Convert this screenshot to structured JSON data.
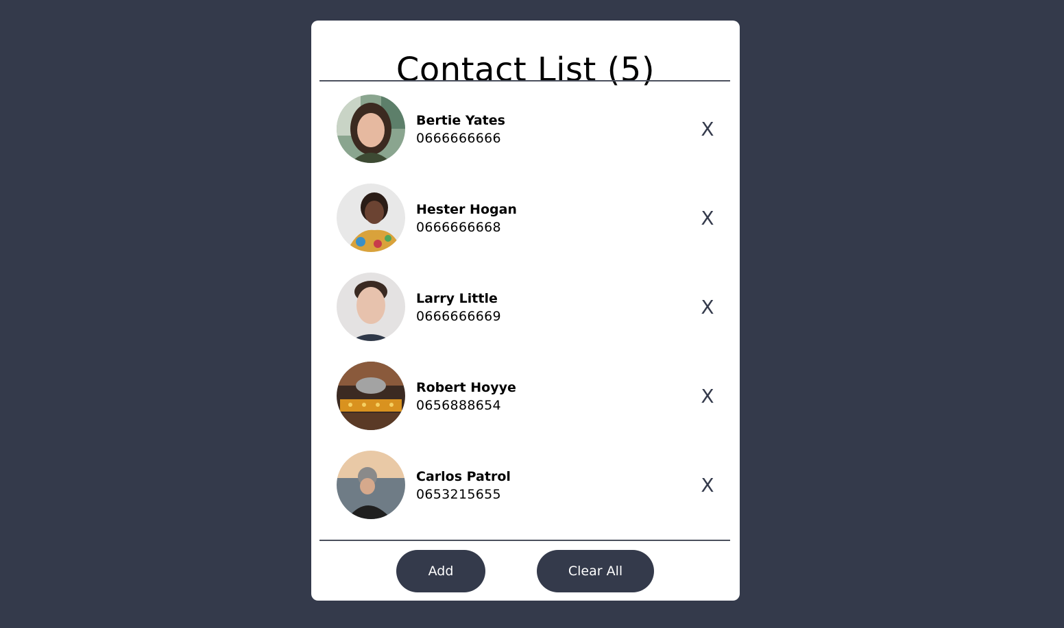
{
  "header": {
    "title": "Contact List (5)"
  },
  "contacts": [
    {
      "name": "Bertie Yates",
      "phone": "0666666666",
      "remove_label": "X"
    },
    {
      "name": "Hester Hogan",
      "phone": "0666666668",
      "remove_label": "X"
    },
    {
      "name": "Larry Little",
      "phone": "0666666669",
      "remove_label": "X"
    },
    {
      "name": "Robert Hoyye",
      "phone": "0656888654",
      "remove_label": "X"
    },
    {
      "name": "Carlos Patrol",
      "phone": "0653215655",
      "remove_label": "X"
    }
  ],
  "actions": {
    "add_label": "Add",
    "clear_label": "Clear All"
  },
  "colors": {
    "background": "#343a4b",
    "card": "#ffffff",
    "button": "#343a4b",
    "button_text": "#ffffff"
  }
}
